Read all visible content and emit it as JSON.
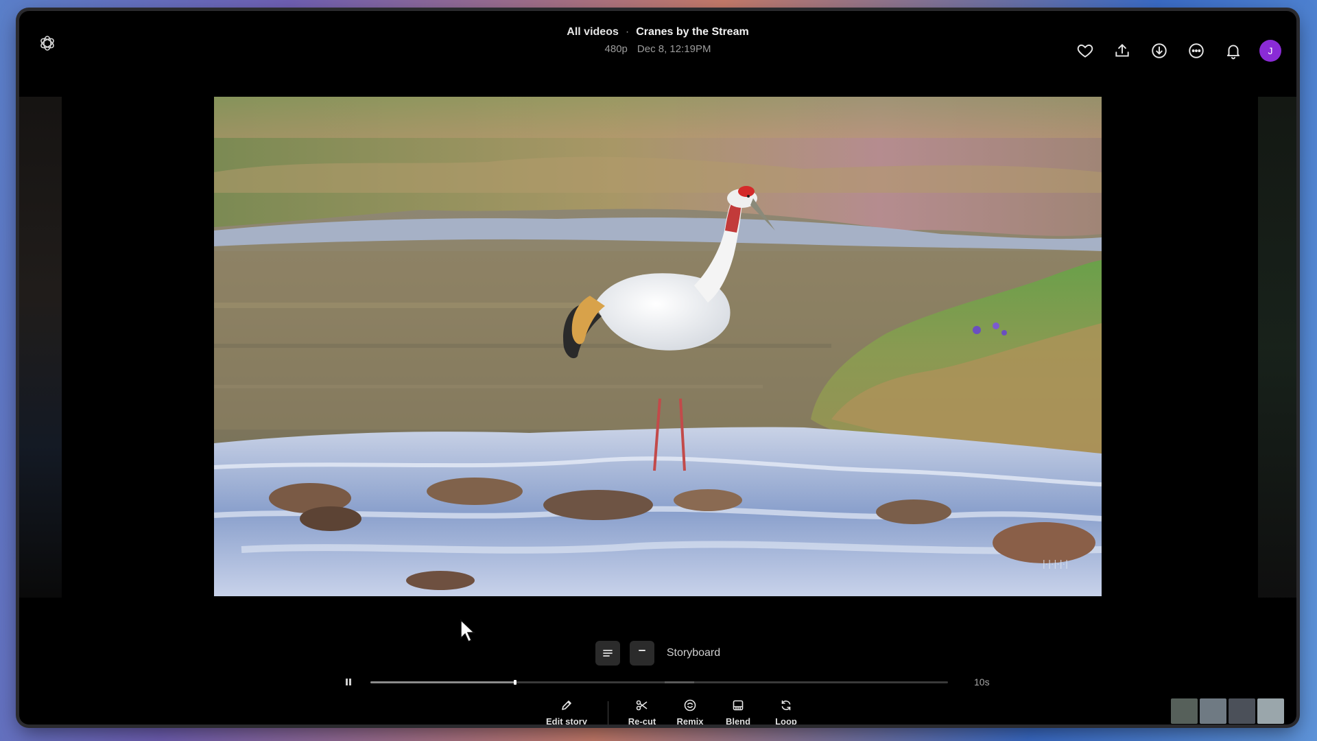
{
  "header": {
    "breadcrumb_parent": "All videos",
    "separator": "·",
    "title": "Cranes by the Stream",
    "resolution": "480p",
    "timestamp": "Dec 8, 12:19PM",
    "avatar_letter": "J"
  },
  "header_icons": [
    "logo-icon",
    "heart-icon",
    "share-icon",
    "download-icon",
    "more-icon",
    "bell-icon"
  ],
  "video": {
    "scene": "red-crowned crane standing in a rocky stream",
    "watermark": "|·|·|·|·|"
  },
  "storyboard": {
    "label": "Storyboard"
  },
  "timeline": {
    "progress": 0.25,
    "buffered_start": 0.51,
    "buffered_end": 0.56,
    "duration": "10s"
  },
  "toolbar": {
    "items": [
      {
        "label": "Edit story",
        "icon": "pencil-icon"
      },
      {
        "label": "Re-cut",
        "icon": "scissors-icon"
      },
      {
        "label": "Remix",
        "icon": "remix-icon"
      },
      {
        "label": "Blend",
        "icon": "blend-icon"
      },
      {
        "label": "Loop",
        "icon": "loop-icon"
      }
    ]
  },
  "thumbnails": {
    "colors": [
      "#56605a",
      "#6f7a83",
      "#4b5059",
      "#9aa6ab"
    ]
  },
  "colors": {
    "avatar": "#8a2bd6",
    "window_bg": "#000000"
  }
}
